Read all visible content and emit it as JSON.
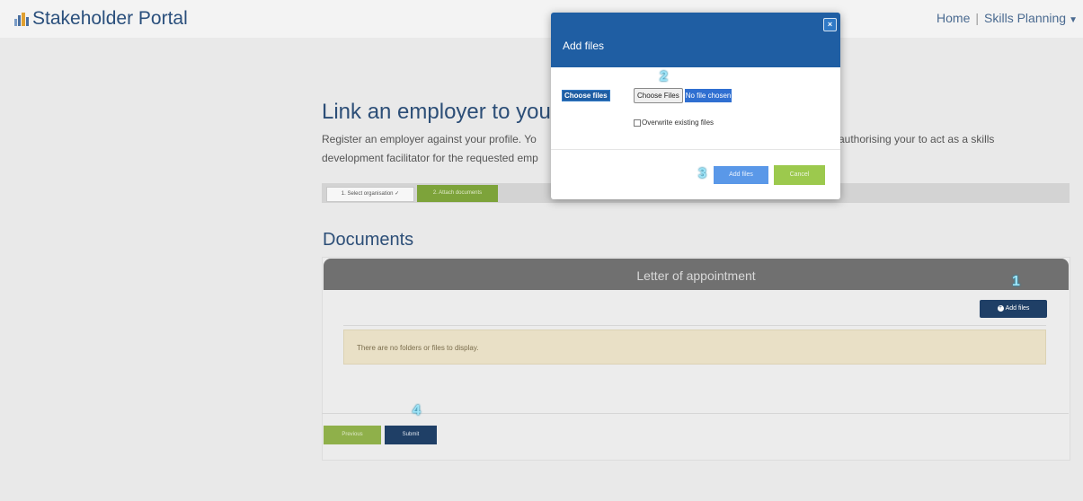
{
  "header": {
    "brand": "Stakeholder Portal",
    "nav_home": "Home",
    "nav_separator": "|",
    "nav_skills": "Skills Planning"
  },
  "page": {
    "title": "Link an employer to your",
    "intro_line1": "Register an employer against your profile. Yo",
    "intro_line2": "development facilitator for the requested emp",
    "intro_tail": "authorising your to act as a skills",
    "steps": [
      "1. Select organisation ✓",
      "2. Attach documents"
    ]
  },
  "documents": {
    "title": "Documents",
    "panel_header": "Letter of appointment",
    "add_files_label": "Add files",
    "empty_message": "There are no folders or files to display."
  },
  "footer_buttons": {
    "previous": "Previous",
    "submit": "Submit"
  },
  "modal": {
    "title": "Add files",
    "close": "×",
    "choose_files_label": "Choose files",
    "choose_files_button": "Choose Files",
    "no_file_text": "No file chosen",
    "overwrite_label": "Overwrite existing files",
    "overwrite_checked": false,
    "add_files_button": "Add files",
    "cancel_button": "Cancel"
  },
  "annotations": {
    "step1": "1",
    "step2": "2",
    "step3": "3",
    "step4": "4"
  },
  "colors": {
    "primary_blue": "#1f5ea3",
    "navy": "#1f3f66",
    "green": "#8fb04a",
    "warning_bg": "#e9e0c6"
  }
}
